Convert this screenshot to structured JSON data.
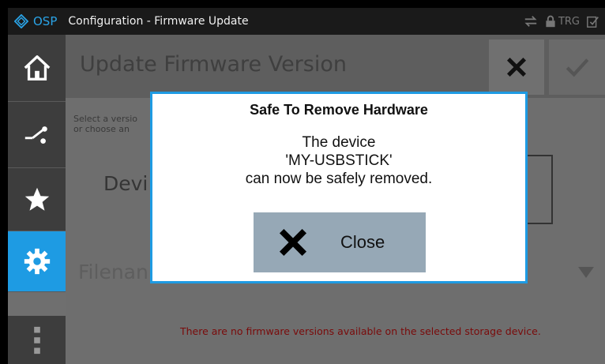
{
  "titlebar": {
    "logo_text": "OSP",
    "title": "Configuration - Firmware Update",
    "status_trg": "TRG"
  },
  "sidebar": {
    "items": [
      {
        "icon": "home-icon"
      },
      {
        "icon": "connections-icon"
      },
      {
        "icon": "star-icon"
      },
      {
        "icon": "gear-icon",
        "active": true
      },
      {
        "icon": "more-icon"
      }
    ]
  },
  "main": {
    "title": "Update Firmware Version",
    "instruction_line1": "Select a versio",
    "instruction_line2": "or choose an",
    "device_label": "Devi",
    "filename_label": "Filenan",
    "error": "There are no firmware versions available on the selected storage device."
  },
  "dialog": {
    "title": "Safe To Remove Hardware",
    "line1": "The device",
    "line2": "'MY-USBSTICK'",
    "line3": "can now be safely removed.",
    "close_label": "Close"
  },
  "colors": {
    "accent": "#1e9be3",
    "error": "#7a0a0a",
    "close_button": "#96a8b6"
  }
}
